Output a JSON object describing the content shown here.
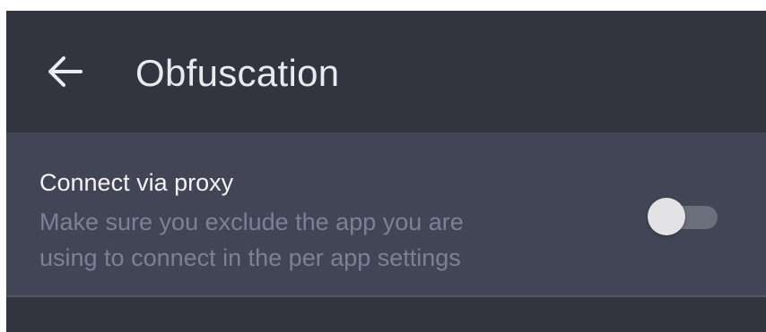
{
  "colors": {
    "app_bar_background": "#32343f",
    "row_background": "#414556",
    "title_text": "#e9eaee",
    "primary_text": "#f3f3f5",
    "secondary_text": "#7d8194",
    "toggle_track_off": "#6b6e7b",
    "toggle_thumb_off": "#e3e3e6"
  },
  "header": {
    "back_icon": "arrow-left-icon",
    "title": "Obfuscation"
  },
  "settings": {
    "proxy": {
      "title": "Connect via proxy",
      "description_lines": [
        "Make sure you exclude the app you are",
        "using to connect in the per app settings"
      ],
      "enabled": false
    }
  }
}
